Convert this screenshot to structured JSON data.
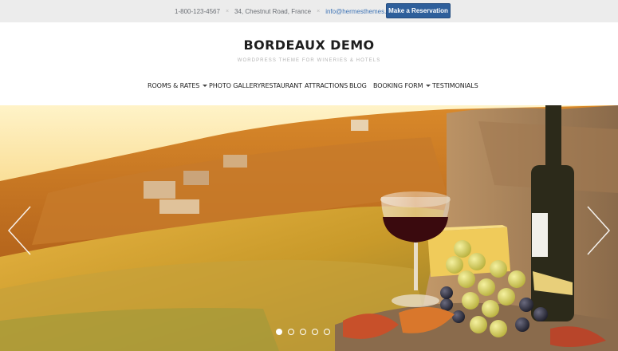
{
  "topbar": {
    "phone": "1-800-123-4567",
    "address": "34, Chestnut Road, France",
    "email": "info@hermesthemes.com",
    "reserve_label": "Make a Reservation",
    "separator": "×"
  },
  "header": {
    "title": "BORDEAUX DEMO",
    "tagline": "WORDPRESS THEME FOR WINERIES & HOTELS"
  },
  "nav": {
    "items": [
      {
        "label": "ROOMS & RATES",
        "dropdown": true
      },
      {
        "label": "PHOTO GALLERY",
        "dropdown": false
      },
      {
        "label": "RESTAURANT",
        "dropdown": false
      },
      {
        "label": "ATTRACTIONS",
        "dropdown": false
      },
      {
        "label": "BLOG",
        "dropdown": false
      },
      {
        "label": "BOOKING FORM",
        "dropdown": true
      },
      {
        "label": "TESTIMONIALS",
        "dropdown": false
      }
    ]
  },
  "slider": {
    "slide_count": 5,
    "active_index": 0,
    "prev_icon": "chevron-left-icon",
    "next_icon": "chevron-right-icon"
  },
  "colors": {
    "accent": "#2e5f9b",
    "email_link": "#3d73b5",
    "topbar_bg": "#ececec"
  }
}
